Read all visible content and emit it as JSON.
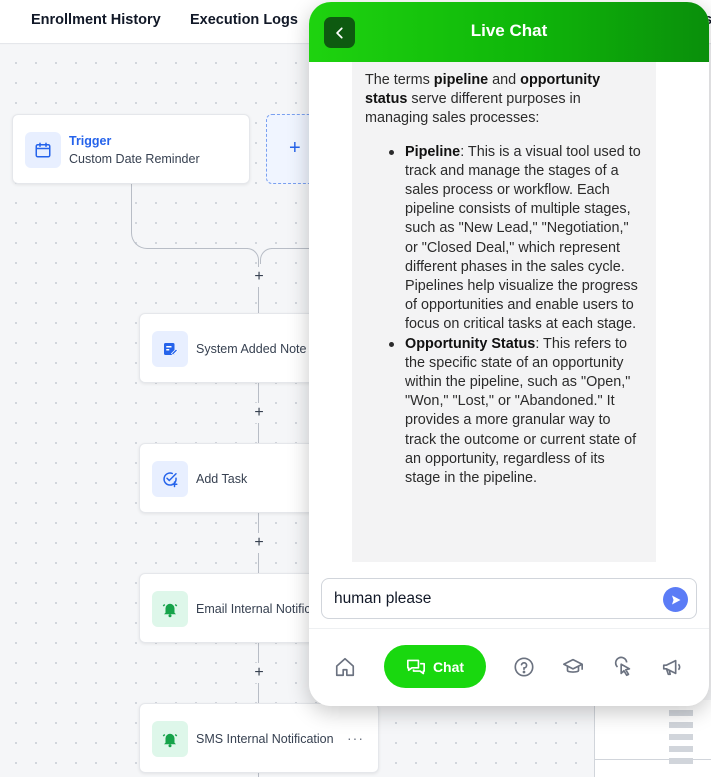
{
  "tabs": {
    "enrollment_history": "Enrollment History",
    "execution_logs": "Execution Logs",
    "partial_tab": "s"
  },
  "workflow": {
    "trigger": {
      "title": "Trigger",
      "subtitle": "Custom Date Reminder"
    },
    "add_trigger_symbol": "+",
    "add_action_symbol": "+",
    "more_symbol": "···",
    "nodes": [
      {
        "label": "System Added Note",
        "icon": "note-edit-icon"
      },
      {
        "label": "Add Task",
        "icon": "task-check-icon"
      },
      {
        "label": "Email Internal Notification",
        "icon": "bell-icon"
      },
      {
        "label": "SMS Internal Notification",
        "icon": "bell-icon"
      }
    ]
  },
  "chat": {
    "title": "Live Chat",
    "message": {
      "intro_pre": "The terms ",
      "intro_bold1": "pipeline",
      "intro_mid": " and ",
      "intro_bold2": "opportunity status",
      "intro_post": " serve different purposes in managing sales processes:",
      "items": [
        {
          "term": "Pipeline",
          "text": ": This is a visual tool used to track and manage the stages of a sales process or workflow. Each pipeline consists of multiple stages, such as \"New Lead,\" \"Negotiation,\" or \"Closed Deal,\" which represent different phases in the sales cycle. Pipelines help visualize the progress of opportunities and enable users to focus on critical tasks at each stage."
        },
        {
          "term": "Opportunity Status",
          "text": ": This refers to the specific state of an opportunity within the pipeline, such as \"Open,\" \"Won,\" \"Lost,\" or \"Abandoned.\" It provides a more granular way to track the outcome or current state of an opportunity, regardless of its stage in the pipeline."
        }
      ]
    },
    "input_value": "human please",
    "nav": {
      "chat_label": "Chat",
      "icons": [
        "home-icon",
        "chat-icon",
        "help-icon",
        "graduation-cap-icon",
        "cursor-click-icon",
        "megaphone-icon"
      ]
    }
  },
  "colors": {
    "header_green": "#1ed30f",
    "chat_pill": "#19d80f",
    "send_button": "#5b7cf6",
    "trigger_title": "#2563eb"
  }
}
